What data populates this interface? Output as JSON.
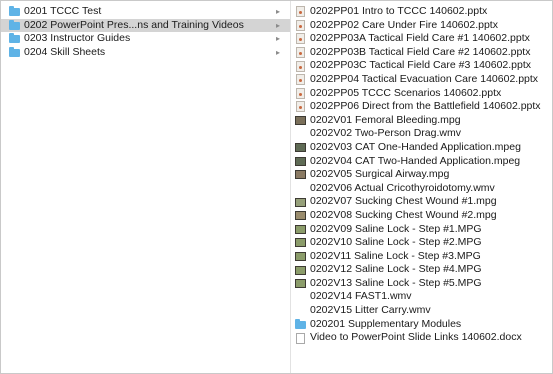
{
  "left_column": {
    "items": [
      {
        "label": "0201 TCCC Test",
        "icon": "folder-icon",
        "selected": false
      },
      {
        "label": "0202 PowerPoint Pres...ns and Training Videos",
        "icon": "folder-icon",
        "selected": true
      },
      {
        "label": "0203 Instructor Guides",
        "icon": "folder-icon",
        "selected": false
      },
      {
        "label": "0204 Skill Sheets",
        "icon": "folder-icon",
        "selected": false
      }
    ],
    "chevron": "▸"
  },
  "right_column": {
    "items": [
      {
        "label": "0202PP01 Intro to TCCC 140602.pptx",
        "icon": "pptx-icon"
      },
      {
        "label": "0202PP02 Care Under Fire 140602.pptx",
        "icon": "pptx-icon"
      },
      {
        "label": "0202PP03A Tactical Field Care #1 140602.pptx",
        "icon": "pptx-icon"
      },
      {
        "label": "0202PP03B Tactical Field Care #2 140602.pptx",
        "icon": "pptx-icon"
      },
      {
        "label": "0202PP03C Tactical Field Care #3 140602.pptx",
        "icon": "pptx-icon"
      },
      {
        "label": "0202PP04 Tactical Evacuation Care 140602.pptx",
        "icon": "pptx-icon"
      },
      {
        "label": "0202PP05 TCCC Scenarios 140602.pptx",
        "icon": "pptx-icon"
      },
      {
        "label": "0202PP06 Direct from the Battlefield 140602.pptx",
        "icon": "pptx-icon"
      },
      {
        "label": "0202V01 Femoral Bleeding.mpg",
        "icon": "video-icon"
      },
      {
        "label": "0202V02 Two-Person Drag.wmv",
        "icon": "blank-icon"
      },
      {
        "label": "0202V03 CAT One-Handed Application.mpeg",
        "icon": "video-icon"
      },
      {
        "label": "0202V04 CAT Two-Handed Application.mpeg",
        "icon": "video-icon"
      },
      {
        "label": "0202V05 Surgical Airway.mpg",
        "icon": "video-icon"
      },
      {
        "label": "0202V06 Actual Cricothyroidotomy.wmv",
        "icon": "blank-icon"
      },
      {
        "label": "0202V07 Sucking Chest Wound #1.mpg",
        "icon": "video-icon"
      },
      {
        "label": "0202V08 Sucking Chest Wound #2.mpg",
        "icon": "video-icon"
      },
      {
        "label": "0202V09 Saline Lock - Step #1.MPG",
        "icon": "video-icon"
      },
      {
        "label": "0202V10 Saline Lock - Step #2.MPG",
        "icon": "video-icon"
      },
      {
        "label": "0202V11 Saline Lock - Step #3.MPG",
        "icon": "video-icon"
      },
      {
        "label": "0202V12 Saline Lock - Step #4.MPG",
        "icon": "video-icon"
      },
      {
        "label": "0202V13 Saline Lock - Step #5.MPG",
        "icon": "video-icon"
      },
      {
        "label": "0202V14 FAST1.wmv",
        "icon": "blank-icon"
      },
      {
        "label": "0202V15 Litter Carry.wmv",
        "icon": "blank-icon"
      },
      {
        "label": "020201 Supplementary Modules",
        "icon": "folder-icon"
      },
      {
        "label": "Video to PowerPoint Slide Links 140602.docx",
        "icon": "doc-icon"
      }
    ]
  }
}
